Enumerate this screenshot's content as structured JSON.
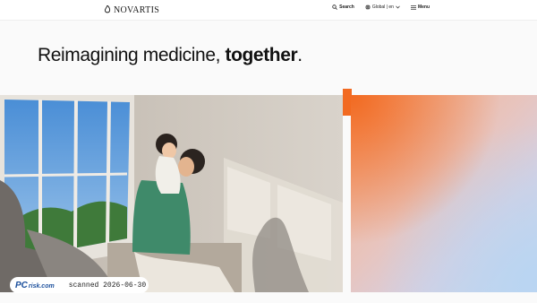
{
  "header": {
    "logo_text": "NOVARTIS",
    "search_label": "Search",
    "locale_label": "Global | en",
    "menu_label": "Menu"
  },
  "hero": {
    "headline_regular": "Reimagining medicine, ",
    "headline_bold": "together",
    "headline_end": "."
  },
  "watermark": {
    "pc": "PC",
    "risk": "risk.com",
    "scanned_text": "scanned 2026-06-30"
  },
  "colors": {
    "accent": "#f26a21",
    "brand_blue": "#1b4f9c"
  }
}
